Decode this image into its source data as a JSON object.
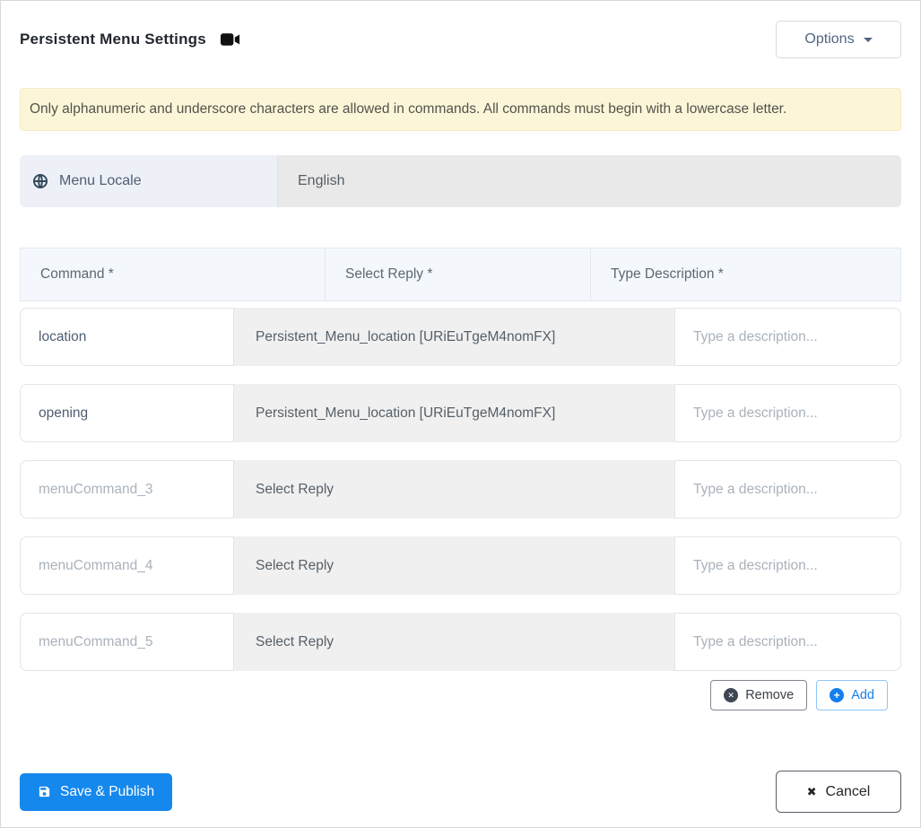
{
  "header": {
    "title": "Persistent Menu Settings",
    "options_label": "Options"
  },
  "banner": {
    "text": "Only alphanumeric and underscore characters are allowed in commands. All commands must begin with a lowercase letter."
  },
  "locale": {
    "label": "Menu Locale",
    "value": "English"
  },
  "table": {
    "headers": {
      "command": "Command *",
      "reply": "Select Reply *",
      "description": "Type Description *"
    },
    "rows": [
      {
        "command_value": "location",
        "reply_label": "Persistent_Menu_location [URiEuTgeM4nomFX]",
        "description_placeholder": "Type a description..."
      },
      {
        "command_value": "opening",
        "reply_label": "Persistent_Menu_location [URiEuTgeM4nomFX]",
        "description_placeholder": "Type a description..."
      },
      {
        "command_placeholder": "menuCommand_3",
        "reply_label": "Select Reply",
        "description_placeholder": "Type a description..."
      },
      {
        "command_placeholder": "menuCommand_4",
        "reply_label": "Select Reply",
        "description_placeholder": "Type a description..."
      },
      {
        "command_placeholder": "menuCommand_5",
        "reply_label": "Select Reply",
        "description_placeholder": "Type a description..."
      }
    ],
    "remove_label": "Remove",
    "add_label": "Add"
  },
  "footer": {
    "save_label": "Save & Publish",
    "cancel_label": "Cancel"
  },
  "icons": {
    "title_icon": "video-camera",
    "locale_icon": "globe",
    "options_icon": "caret-down",
    "remove_glyph": "✕",
    "add_glyph": "+",
    "save_icon": "floppy-disk",
    "cancel_glyph": "✖"
  },
  "colors": {
    "primary_blue": "#1588ee",
    "add_blue": "#187fe8",
    "banner_bg": "#fcf6d9",
    "table_header_bg": "#f4f7fb",
    "reply_cell_bg": "#f0f0f0",
    "locale_label_bg": "#edf1f7",
    "locale_value_bg": "#e9e9e9"
  }
}
